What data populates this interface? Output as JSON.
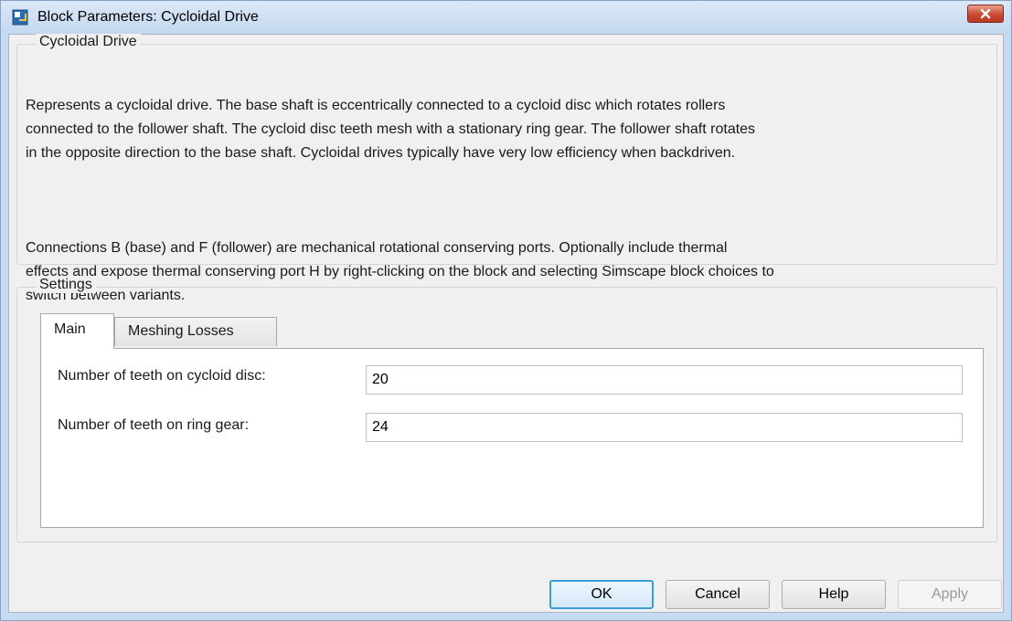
{
  "window": {
    "title": "Block Parameters: Cycloidal Drive",
    "close_icon": "close-icon",
    "title_icon": "simulink-block-icon"
  },
  "description_group": {
    "label": "Cycloidal Drive",
    "paragraph1": "Represents a cycloidal drive. The base shaft is eccentrically connected to a cycloid disc which rotates rollers\nconnected to the follower shaft. The cycloid disc teeth mesh with a stationary ring gear. The follower shaft rotates\nin the opposite direction to the base shaft. Cycloidal drives typically have very low efficiency when backdriven.",
    "paragraph2": "Connections B (base) and F (follower) are mechanical rotational conserving ports. Optionally include thermal\neffects and expose thermal conserving port H by right-clicking on the block and selecting Simscape block choices to\nswitch between variants."
  },
  "settings_group": {
    "label": "Settings",
    "tabs": [
      {
        "label": "Main",
        "active": true
      },
      {
        "label": "Meshing Losses",
        "active": false
      }
    ],
    "params": [
      {
        "label": "Number of teeth on cycloid disc:",
        "value": "20"
      },
      {
        "label": "Number of teeth on ring gear:",
        "value": "24"
      }
    ]
  },
  "buttons": {
    "ok": "OK",
    "cancel": "Cancel",
    "help": "Help",
    "apply": "Apply"
  },
  "colors": {
    "title_bar": "#c4d8f0",
    "close_button": "#c84a32",
    "default_button_border": "#3c9ed8"
  }
}
